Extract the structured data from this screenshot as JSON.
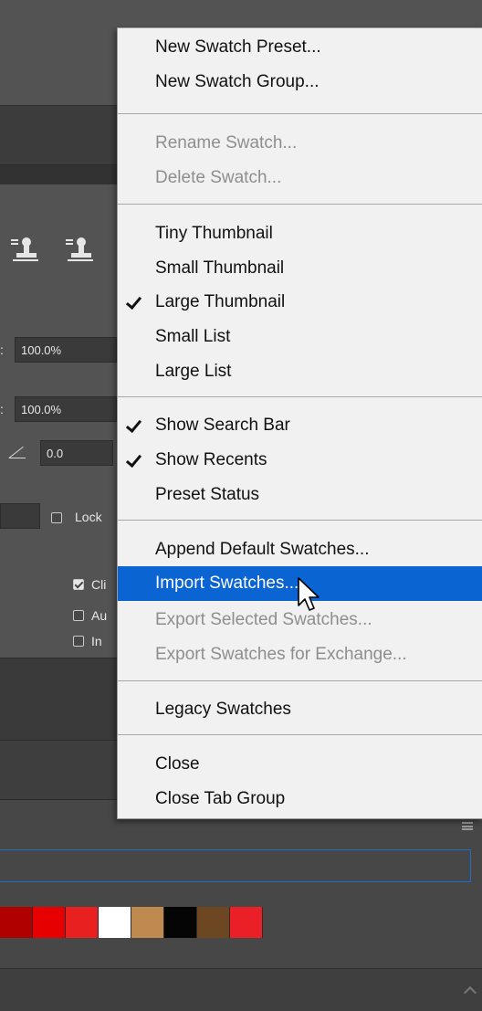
{
  "panel": {
    "opacity_value": "100.0%",
    "fill_value": "100.0%",
    "angle_value": "0.0",
    "lock_label": "Lock",
    "clip_label": "Cli",
    "auto_label": "Au",
    "invert_label": "In"
  },
  "swatches": [
    "#b00000",
    "#e60000",
    "#e82020",
    "#ffffff",
    "#bf8a4f",
    "#050505",
    "#6d4721",
    "#ea2026"
  ],
  "menu": {
    "items": [
      {
        "label": "New Swatch Preset...",
        "state": "enabled",
        "checked": false
      },
      {
        "label": "New Swatch Group...",
        "state": "enabled",
        "checked": false
      },
      {
        "label": "Rename Swatch...",
        "state": "disabled",
        "checked": false
      },
      {
        "label": "Delete Swatch...",
        "state": "disabled",
        "checked": false
      },
      {
        "label": "Tiny Thumbnail",
        "state": "enabled",
        "checked": false
      },
      {
        "label": "Small Thumbnail",
        "state": "enabled",
        "checked": false
      },
      {
        "label": "Large Thumbnail",
        "state": "enabled",
        "checked": true
      },
      {
        "label": "Small List",
        "state": "enabled",
        "checked": false
      },
      {
        "label": "Large List",
        "state": "enabled",
        "checked": false
      },
      {
        "label": "Show Search Bar",
        "state": "enabled",
        "checked": true
      },
      {
        "label": "Show Recents",
        "state": "enabled",
        "checked": true
      },
      {
        "label": "Preset Status",
        "state": "enabled",
        "checked": false
      },
      {
        "label": "Append Default Swatches...",
        "state": "enabled",
        "checked": false
      },
      {
        "label": "Import Swatches...",
        "state": "highlighted",
        "checked": false
      },
      {
        "label": "Export Selected Swatches...",
        "state": "disabled",
        "checked": false
      },
      {
        "label": "Export Swatches for Exchange...",
        "state": "disabled",
        "checked": false
      },
      {
        "label": "Legacy Swatches",
        "state": "enabled",
        "checked": false
      },
      {
        "label": "Close",
        "state": "enabled",
        "checked": false
      },
      {
        "label": "Close Tab Group",
        "state": "enabled",
        "checked": false
      }
    ],
    "highlight_color": "#0a64d2"
  }
}
